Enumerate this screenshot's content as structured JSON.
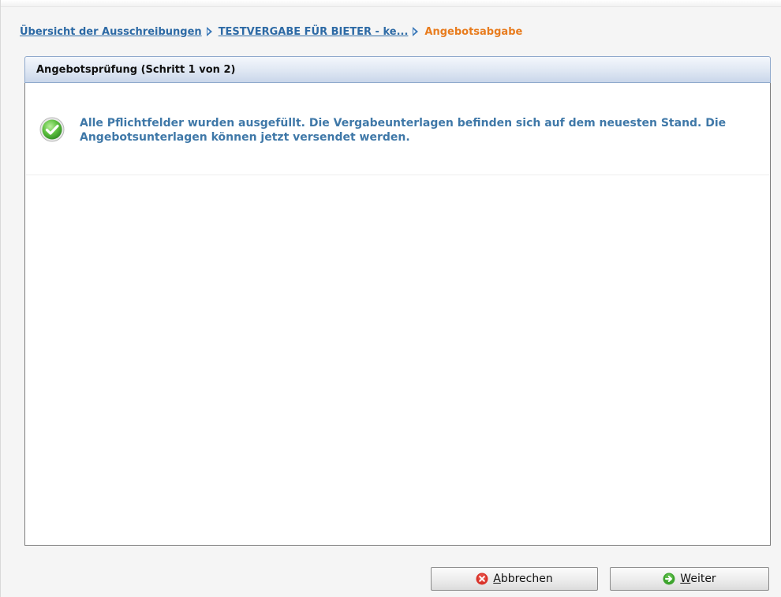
{
  "breadcrumb": {
    "items": [
      {
        "label": "Übersicht der Ausschreibungen"
      },
      {
        "label": "TESTVERGABE FÜR BIETER - ke..."
      }
    ],
    "current": "Angebotsabgabe"
  },
  "panel": {
    "title": "Angebotsprüfung (Schritt 1 von 2)",
    "message": {
      "line1": "Alle Pflichtfelder wurden ausgefüllt. Die Vergabeunterlagen befinden sich auf dem neuesten Stand. Die",
      "line2": "Angebotsunterlagen können jetzt versendet werden.",
      "icon": "success-check-icon"
    }
  },
  "buttons": {
    "cancel": {
      "mnemonic": "A",
      "rest": "bbrechen",
      "icon": "cancel-x-icon"
    },
    "next": {
      "mnemonic": "W",
      "rest": "eiter",
      "icon": "arrow-right-icon"
    }
  },
  "colors": {
    "link": "#2d6aa5",
    "current_crumb": "#e87c1e",
    "message_text": "#3f78a8",
    "success": "#4caf3c",
    "cancel_icon": "#d9342b",
    "next_icon": "#3ea42f"
  }
}
